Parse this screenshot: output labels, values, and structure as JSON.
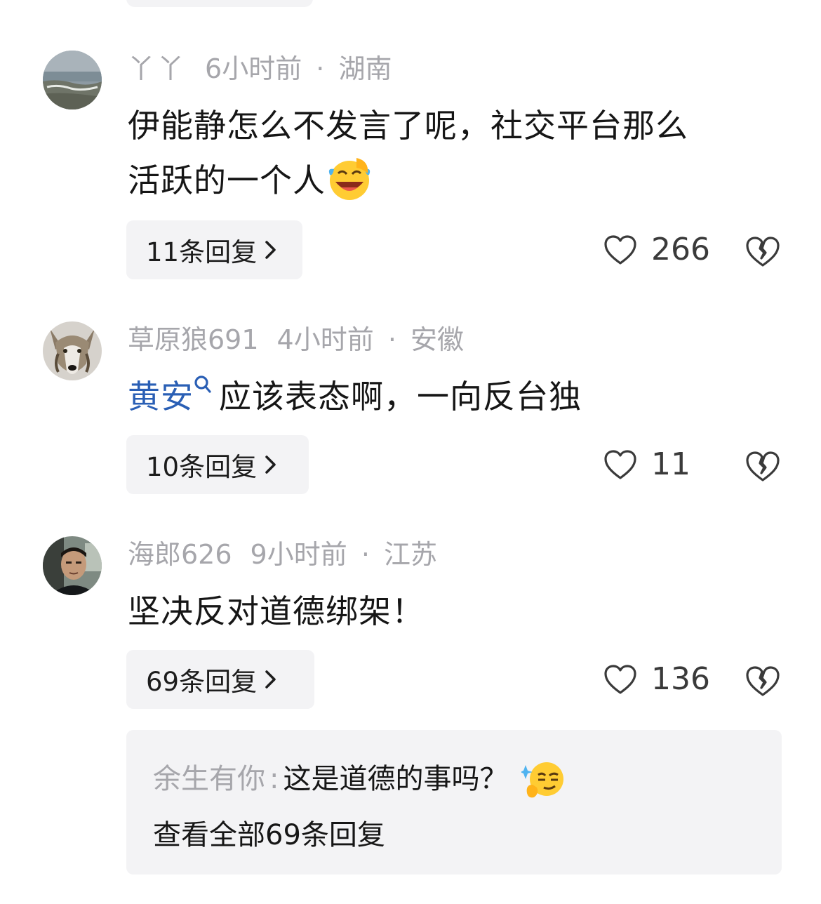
{
  "comments": [
    {
      "username": "丫丫",
      "time": "6小时前",
      "location": "湖南",
      "text_line1": "伊能静怎么不发言了呢，社交平台那么",
      "text_line2": "活跃的一个人",
      "text_emoji": "laughing-crying-emoji",
      "replies_label": "11条回复",
      "likes": "266"
    },
    {
      "username": "草原狼691",
      "time": "4小时前",
      "location": "安徽",
      "mention": "黄安",
      "text": "应该表态啊，一向反台独",
      "replies_label": "10条回复",
      "likes": "11"
    },
    {
      "username": "海郎626",
      "time": "9小时前",
      "location": "江苏",
      "text": "坚决反对道德绑架！",
      "replies_label": "69条回复",
      "likes": "136",
      "sub_reply": {
        "username": "余生有你",
        "separator": ":",
        "text": "这是道德的事吗？",
        "emoji": "smug-emoji",
        "view_all": "查看全部69条回复"
      }
    }
  ],
  "separator_dot": "·",
  "colors": {
    "meta_gray": "#a6a6ab",
    "mention_blue": "#2a5fb5",
    "pill_bg": "#f3f3f5"
  }
}
